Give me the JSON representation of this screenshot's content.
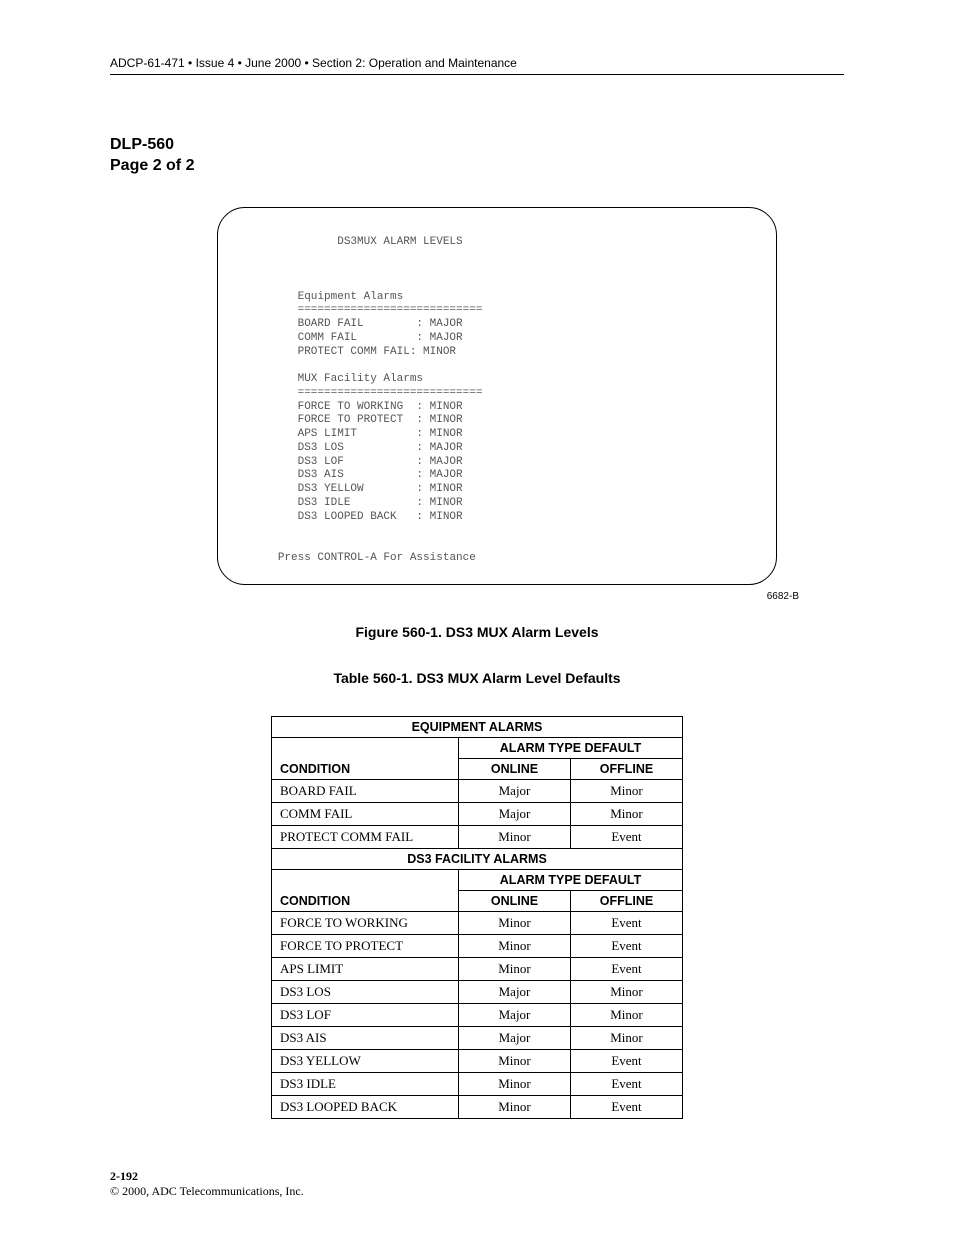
{
  "header": "ADCP-61-471 • Issue 4 • June 2000 • Section 2: Operation and Maintenance",
  "dlp": {
    "line1": "DLP-560",
    "line2": "Page 2 of 2"
  },
  "terminal": {
    "title": "DS3MUX ALARM LEVELS",
    "section1_title": "Equipment Alarms",
    "rule": "============================",
    "eq": {
      "l1": "BOARD FAIL        : MAJOR",
      "l2": "COMM FAIL         : MAJOR",
      "l3": "PROTECT COMM FAIL: MINOR"
    },
    "section2_title": "MUX Facility Alarms",
    "fac": {
      "l1": "FORCE TO WORKING  : MINOR",
      "l2": "FORCE TO PROTECT  : MINOR",
      "l3": "APS LIMIT         : MINOR",
      "l4": "DS3 LOS           : MAJOR",
      "l5": "DS3 LOF           : MAJOR",
      "l6": "DS3 AIS           : MAJOR",
      "l7": "DS3 YELLOW        : MINOR",
      "l8": "DS3 IDLE          : MINOR",
      "l9": "DS3 LOOPED BACK   : MINOR"
    },
    "footer": "Press CONTROL-A For Assistance"
  },
  "fig_id": "6682-B",
  "fig_caption": "Figure 560-1. DS3 MUX Alarm Levels",
  "table_caption": "Table 560-1. DS3 MUX Alarm Level Defaults",
  "table": {
    "sec1": "EQUIPMENT ALARMS",
    "alarm_type": "ALARM TYPE DEFAULT",
    "cond": "CONDITION",
    "online": "ONLINE",
    "offline": "OFFLINE",
    "eq_rows": [
      {
        "c": "BOARD FAIL",
        "on": "Major",
        "off": "Minor"
      },
      {
        "c": "COMM FAIL",
        "on": "Major",
        "off": "Minor"
      },
      {
        "c": "PROTECT COMM FAIL",
        "on": "Minor",
        "off": "Event"
      }
    ],
    "sec2": "DS3 FACILITY ALARMS",
    "fac_rows": [
      {
        "c": "FORCE TO WORKING",
        "on": "Minor",
        "off": "Event"
      },
      {
        "c": "FORCE TO PROTECT",
        "on": "Minor",
        "off": "Event"
      },
      {
        "c": "APS LIMIT",
        "on": "Minor",
        "off": "Event"
      },
      {
        "c": "DS3 LOS",
        "on": "Major",
        "off": "Minor"
      },
      {
        "c": "DS3 LOF",
        "on": "Major",
        "off": "Minor"
      },
      {
        "c": "DS3 AIS",
        "on": "Major",
        "off": "Minor"
      },
      {
        "c": "DS3 YELLOW",
        "on": "Minor",
        "off": "Event"
      },
      {
        "c": "DS3 IDLE",
        "on": "Minor",
        "off": "Event"
      },
      {
        "c": "DS3 LOOPED BACK",
        "on": "Minor",
        "off": "Event"
      }
    ]
  },
  "footer": {
    "page": "2-192",
    "copyright": "© 2000, ADC Telecommunications, Inc."
  }
}
